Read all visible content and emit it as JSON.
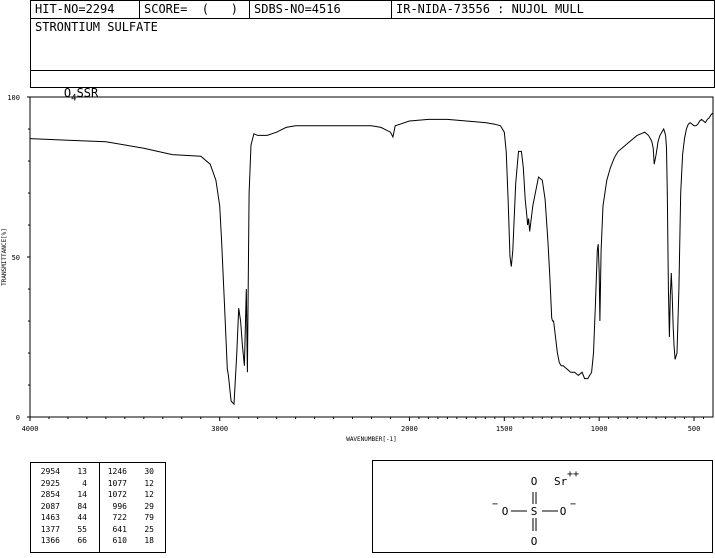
{
  "header": {
    "hit_no": "HIT-NO=2294",
    "score": "SCORE=  (   )",
    "sdbs_no": "SDBS-NO=4516",
    "ir_info": "IR-NIDA-73556 : NUJOL MULL"
  },
  "compound": {
    "name": "STRONTIUM SULFATE",
    "formula_main": "O",
    "formula_sub": "4",
    "formula_rest": "SSR"
  },
  "chart_data": {
    "type": "line",
    "xlabel": "WAVENUMBER[-1]",
    "ylabel": "TRANSMITTANCE[%]",
    "xlim": [
      4000,
      400
    ],
    "ylim": [
      0,
      100
    ],
    "x_ticks": [
      4000,
      3000,
      2000,
      1500,
      1000,
      500
    ],
    "y_ticks": [
      0,
      50,
      100
    ],
    "x": [
      4000,
      3800,
      3600,
      3400,
      3250,
      3100,
      3050,
      3020,
      3000,
      2990,
      2975,
      2960,
      2954,
      2940,
      2925,
      2910,
      2900,
      2890,
      2880,
      2870,
      2860,
      2854,
      2845,
      2835,
      2820,
      2800,
      2750,
      2700,
      2650,
      2600,
      2500,
      2400,
      2300,
      2200,
      2150,
      2100,
      2087,
      2075,
      2050,
      2000,
      1900,
      1800,
      1700,
      1600,
      1550,
      1520,
      1500,
      1490,
      1480,
      1470,
      1463,
      1455,
      1440,
      1425,
      1410,
      1400,
      1390,
      1380,
      1377,
      1372,
      1366,
      1350,
      1320,
      1300,
      1285,
      1270,
      1260,
      1250,
      1246,
      1240,
      1230,
      1220,
      1210,
      1200,
      1190,
      1170,
      1150,
      1130,
      1110,
      1090,
      1077,
      1072,
      1060,
      1050,
      1040,
      1030,
      1020,
      1010,
      1005,
      1000,
      996,
      990,
      980,
      960,
      940,
      920,
      900,
      880,
      860,
      840,
      820,
      800,
      780,
      760,
      740,
      730,
      722,
      715,
      710,
      700,
      690,
      680,
      670,
      660,
      650,
      645,
      641,
      635,
      630,
      625,
      620,
      615,
      610,
      605,
      600,
      590,
      580,
      570,
      560,
      550,
      540,
      530,
      520,
      510,
      500,
      490,
      480,
      470,
      460,
      450,
      440,
      430,
      420,
      410,
      400
    ],
    "y": [
      87,
      86.5,
      86,
      84,
      82,
      81.5,
      79,
      74,
      66,
      55,
      35,
      15,
      13,
      5,
      4,
      20,
      34,
      30,
      22,
      16,
      40,
      14,
      70,
      85,
      88.5,
      88,
      88,
      89,
      90.5,
      91,
      91,
      91,
      91,
      91,
      90.5,
      89,
      87.5,
      91,
      91.5,
      92.5,
      93,
      93,
      92.5,
      92,
      91.5,
      91,
      89,
      83,
      68,
      50,
      47,
      52,
      73,
      83,
      83,
      78,
      68,
      62,
      60,
      62,
      58,
      66,
      75,
      74,
      68,
      55,
      44,
      31,
      30,
      30,
      25,
      20,
      17,
      16,
      16,
      15,
      14,
      14,
      13,
      14,
      12,
      12,
      12,
      13,
      14,
      20,
      35,
      52,
      54,
      45,
      30,
      52,
      66,
      74,
      78,
      81,
      83,
      84,
      85,
      86,
      87,
      88,
      88.5,
      89,
      88,
      87,
      86,
      84,
      79,
      82,
      86,
      88,
      89,
      90,
      88,
      84,
      70,
      40,
      25,
      38,
      45,
      38,
      28,
      22,
      18,
      20,
      40,
      70,
      82,
      87,
      90,
      91.5,
      92,
      91.5,
      91,
      91,
      91.5,
      92.5,
      93,
      92.5,
      92,
      93,
      93.5,
      94.5,
      95,
      94,
      89,
      85,
      80
    ],
    "peak_table": [
      [
        "2954",
        "13",
        "1246",
        "30"
      ],
      [
        "2925",
        "4",
        "1077",
        "12"
      ],
      [
        "2854",
        "14",
        "1072",
        "12"
      ],
      [
        "2087",
        "84",
        "996",
        "29"
      ],
      [
        "1463",
        "44",
        "722",
        "79"
      ],
      [
        "1377",
        "55",
        "641",
        "25"
      ],
      [
        "1366",
        "66",
        "610",
        "18"
      ]
    ]
  },
  "structure": {
    "sr_label": "Sr",
    "sr_charge": "++",
    "atom_o": "O",
    "atom_s": "S",
    "minus": "−"
  }
}
